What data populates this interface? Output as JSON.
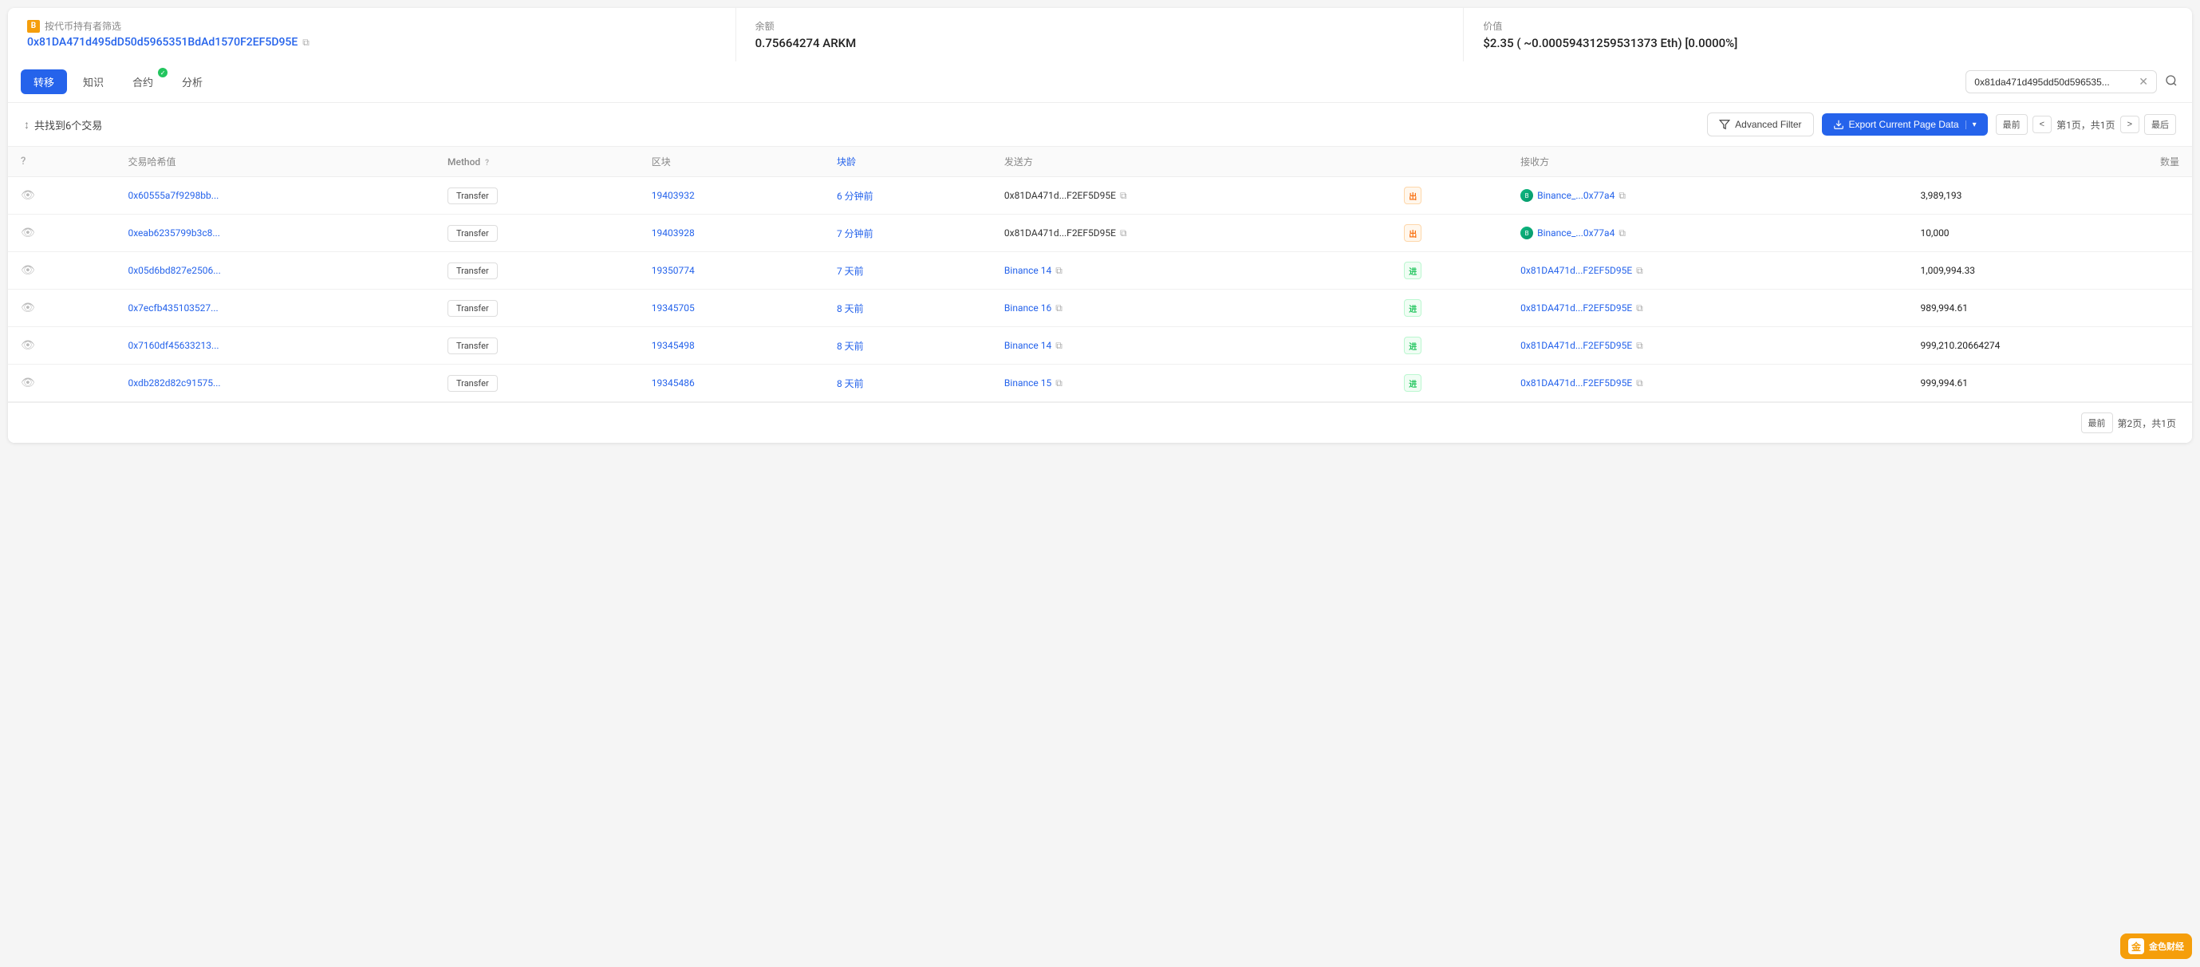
{
  "header": {
    "filter_label": "按代币持有者筛选",
    "tag_icon": "B",
    "address": "0x81DA471d495dD50d5965351BdAd1570F2EF5D95E",
    "balance_label": "余额",
    "balance_value": "0.75664274 ARKM",
    "value_label": "价值",
    "value_value": "$2.35 ( ~0.00059431259531373 Eth) [0.0000%]"
  },
  "tabs": {
    "items": [
      {
        "label": "转移",
        "active": true
      },
      {
        "label": "知识",
        "active": false
      },
      {
        "label": "合约",
        "active": false,
        "has_check": true
      },
      {
        "label": "分析",
        "active": false
      }
    ]
  },
  "search": {
    "placeholder": "0x81da471d495dd50d596535...",
    "value": "0x81da471d495dd50d596535..."
  },
  "toolbar": {
    "sort_icon": "↕",
    "results_text": "共找到6个交易",
    "filter_btn_label": "Advanced Filter",
    "export_btn_label": "Export Current Page Data",
    "pagination": {
      "first_label": "最前",
      "prev_label": "<",
      "page_info": "第1页，共1页",
      "next_label": ">",
      "last_label": "最后"
    }
  },
  "table": {
    "headers": [
      "",
      "交易哈希值",
      "Method",
      "区块",
      "块龄",
      "发送方",
      "",
      "接收方",
      "数量"
    ],
    "rows": [
      {
        "hash": "0x60555a7f9298bb...",
        "method": "Transfer",
        "block": "19403932",
        "age": "6 分钟前",
        "sender": "0x81DA471d...F2EF5D95E",
        "direction": "出",
        "direction_type": "out",
        "receiver_icon": true,
        "receiver": "Binance_...0x77a4",
        "amount": "3,989,193"
      },
      {
        "hash": "0xeab6235799b3c8...",
        "method": "Transfer",
        "block": "19403928",
        "age": "7 分钟前",
        "sender": "0x81DA471d...F2EF5D95E",
        "direction": "出",
        "direction_type": "out",
        "receiver_icon": true,
        "receiver": "Binance_...0x77a4",
        "amount": "10,000"
      },
      {
        "hash": "0x05d6bd827e2506...",
        "method": "Transfer",
        "block": "19350774",
        "age": "7 天前",
        "sender": "Binance 14",
        "sender_is_link": true,
        "direction": "进",
        "direction_type": "in",
        "receiver_icon": false,
        "receiver": "0x81DA471d...F2EF5D95E",
        "amount": "1,009,994.33"
      },
      {
        "hash": "0x7ecfb435103527...",
        "method": "Transfer",
        "block": "19345705",
        "age": "8 天前",
        "sender": "Binance 16",
        "sender_is_link": true,
        "direction": "进",
        "direction_type": "in",
        "receiver_icon": false,
        "receiver": "0x81DA471d...F2EF5D95E",
        "amount": "989,994.61"
      },
      {
        "hash": "0x7160df45633213...",
        "method": "Transfer",
        "block": "19345498",
        "age": "8 天前",
        "sender": "Binance 14",
        "sender_is_link": true,
        "direction": "进",
        "direction_type": "in",
        "receiver_icon": false,
        "receiver": "0x81DA471d...F2EF5D95E",
        "amount": "999,210.20664274"
      },
      {
        "hash": "0xdb282d82c91575...",
        "method": "Transfer",
        "block": "19345486",
        "age": "8 天前",
        "sender": "Binance 15",
        "sender_is_link": true,
        "direction": "进",
        "direction_type": "in",
        "receiver_icon": false,
        "receiver": "0x81DA471d...F2EF5D95E",
        "amount": "999,994.61"
      }
    ]
  },
  "bottom": {
    "first_label": "最前",
    "page_info": "第2页，共1页"
  },
  "watermark": {
    "text": "金色财经"
  }
}
